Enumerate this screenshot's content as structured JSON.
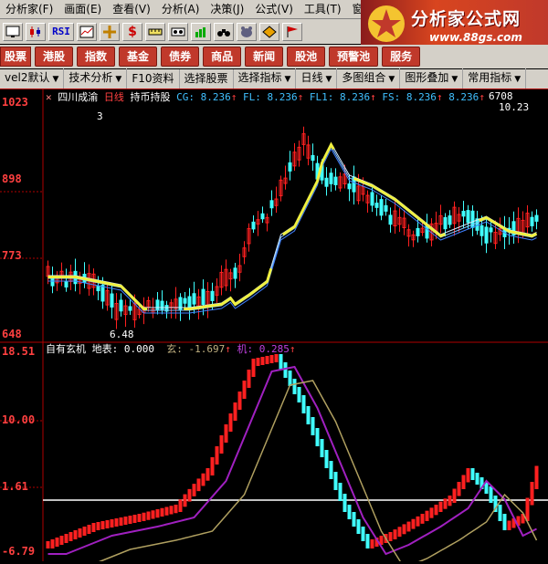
{
  "menu": {
    "items": [
      "分析家(F)",
      "画面(E)",
      "查看(V)",
      "分析(A)",
      "决策(J)",
      "公式(V)",
      "工具(T)",
      "窗口(W)"
    ]
  },
  "logo": {
    "title": "分析家公式网",
    "url": "www.88gs.com"
  },
  "toolbar": {
    "rsi_label": "RSI",
    "icons": [
      "monitor-icon",
      "kline-icon",
      "rsi-icon",
      "overlay-icon",
      "crosshair-icon",
      "dollar-icon",
      "ruler-icon",
      "tape-icon",
      "chart-icon",
      "binoculars-icon",
      "bear-icon",
      "diamond-icon",
      "flag-icon"
    ]
  },
  "market_bar": {
    "buttons": [
      "股票",
      "港股",
      "指数",
      "基金",
      "债券",
      "商品",
      "新闻",
      "股池",
      "预警池",
      "服务"
    ]
  },
  "function_bar": {
    "items": [
      "vel2默认",
      "技术分析",
      "F10资料",
      "选择股票",
      "选择指标",
      "日线",
      "多图组合",
      "图形叠加",
      "常用指标"
    ]
  },
  "main_chart": {
    "title": "四川成渝",
    "period": "日线",
    "indicator": "持币持股",
    "cg_label": "CG: 8.236",
    "fl_label": "FL: 8.236",
    "fl1_label": "FL1: 8.236",
    "fs_label": "FS: 8.236",
    "extra_label": "8.236",
    "ticker_right": "6708",
    "high_label": "10.23",
    "low_label": "6.48",
    "marker_num": "3",
    "y_ticks": [
      "1023",
      "898",
      "773",
      "648"
    ]
  },
  "sub_chart": {
    "title": "自有玄机",
    "label_ground": "地表: 0.000",
    "label_xuan": "玄: -1.697",
    "label_ji": "机: 0.285",
    "y_ticks": [
      "18.51",
      "10.00",
      "1.61",
      "-6.79"
    ]
  },
  "colors": {
    "up": "#ff2020",
    "down": "#40ffff",
    "ma_yellow": "#f0f040",
    "ma_blue": "#1e90ff",
    "axis": "#b00000",
    "xuan": "#b0a060",
    "ji": "#a020c0"
  }
}
